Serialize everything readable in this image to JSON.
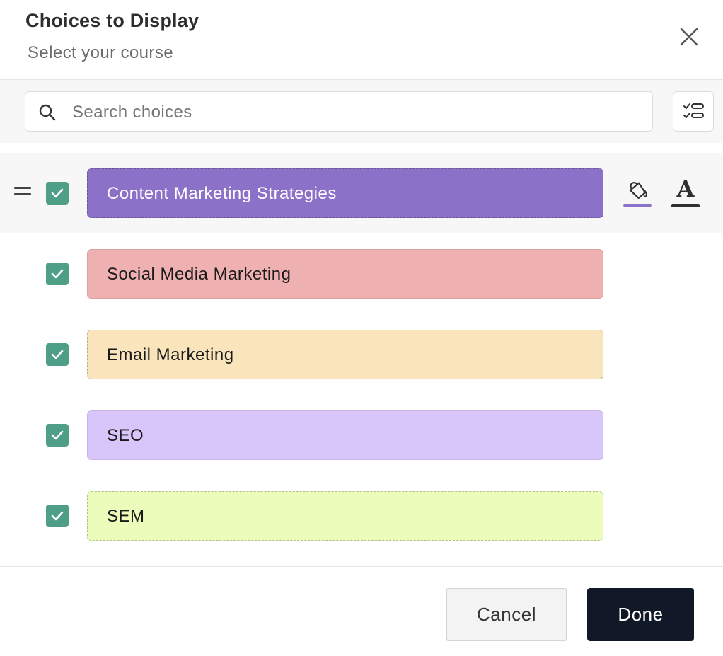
{
  "dialog": {
    "title": "Choices to Display",
    "subtitle": "Select your course",
    "close_icon": "close-icon"
  },
  "search": {
    "placeholder": "Search choices",
    "value": "",
    "icon": "search-icon"
  },
  "toolbar": {
    "layout_icon": "checklist-icon"
  },
  "choices": [
    {
      "label": "Content Marketing Strategies",
      "checked": true,
      "bg": "#8b71c7",
      "text_color": "#ffffff",
      "border": "dashed",
      "selected": true
    },
    {
      "label": "Social Media Marketing",
      "checked": true,
      "bg": "#eeb0b0",
      "text_color": "#1a1a1a",
      "border": "solid"
    },
    {
      "label": "Email Marketing",
      "checked": true,
      "bg": "#f9e4bc",
      "text_color": "#1a1a1a",
      "border": "dashed"
    },
    {
      "label": "SEO",
      "checked": true,
      "bg": "#d8c5fa",
      "text_color": "#1a1a1a",
      "border": "solid"
    },
    {
      "label": "SEM",
      "checked": true,
      "bg": "#ebfcbb",
      "text_color": "#1a1a1a",
      "border": "dashed"
    }
  ],
  "style_tools": {
    "fill_icon": "paint-bucket-icon",
    "fill_color": "#8b71c7",
    "text_icon": "text-color-icon",
    "text_glyph": "A",
    "text_color": "#2f2f2f"
  },
  "footer": {
    "cancel_label": "Cancel",
    "done_label": "Done"
  },
  "colors": {
    "checkbox": "#4f9e86",
    "primary_button": "#111827"
  }
}
